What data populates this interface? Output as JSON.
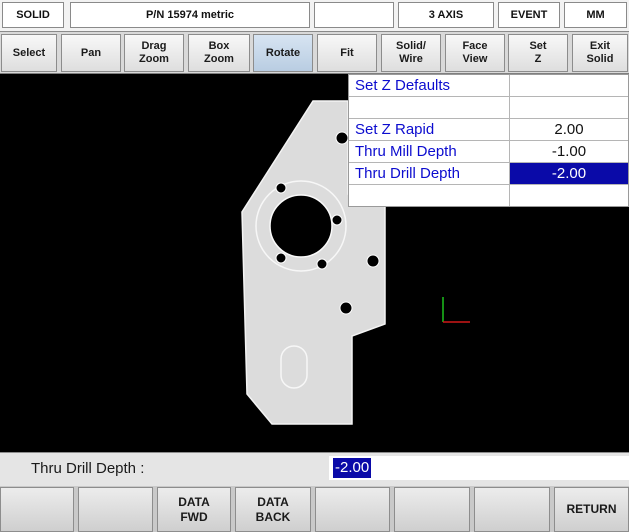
{
  "status_bar": {
    "mode": "SOLID",
    "part_number": "P/N 15974 metric",
    "blank": "",
    "axis": "3 AXIS",
    "event": "EVENT",
    "units": "MM"
  },
  "toolbar": {
    "select": "Select",
    "pan": "Pan",
    "drag_zoom": "Drag\nZoom",
    "box_zoom": "Box\nZoom",
    "rotate": "Rotate",
    "fit": "Fit",
    "solid_wire": "Solid/\nWire",
    "face_view": "Face\nView",
    "set_z": "Set\nZ",
    "exit_solid": "Exit\nSolid"
  },
  "z_defaults": {
    "title": "Set Z Defaults",
    "rows": [
      {
        "label": "Set Z Rapid",
        "value": "2.00"
      },
      {
        "label": "Thru Mill Depth",
        "value": "-1.00"
      },
      {
        "label": "Thru Drill Depth",
        "value": "-2.00",
        "selected": true
      }
    ]
  },
  "prompt": {
    "label": "Thru Drill Depth :",
    "value": "-2.00"
  },
  "softkeys": {
    "data_fwd": "DATA\nFWD",
    "data_back": "DATA\nBACK",
    "return": "RETURN"
  },
  "colors": {
    "table_label_text": "#0c0ccf",
    "selection_bg": "#0a0aa8",
    "part_fill": "#dcdcdc",
    "axis_x": "#d01818",
    "axis_y": "#1cc01c"
  }
}
